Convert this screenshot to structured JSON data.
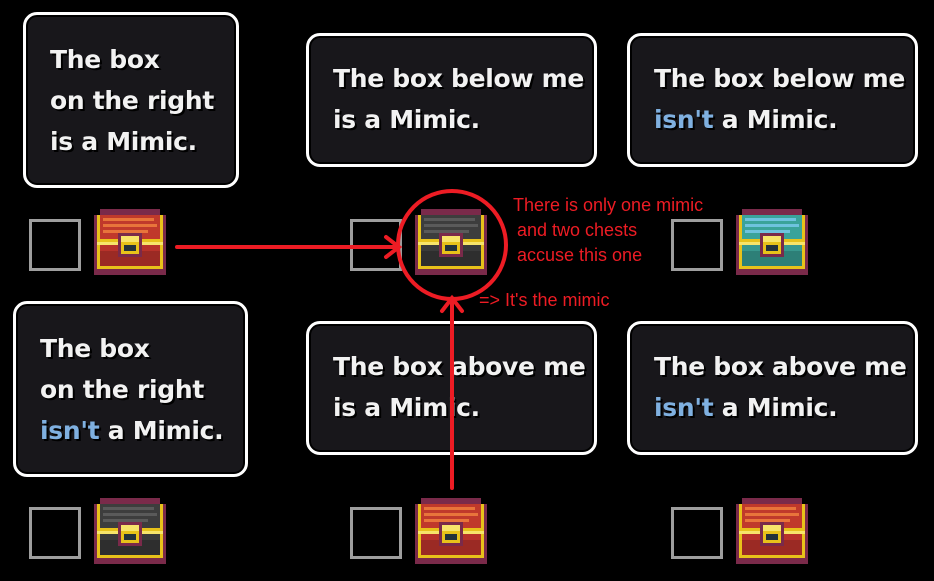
{
  "clues": [
    {
      "lines": [
        {
          "text": "The box"
        },
        {
          "text": "on the right"
        },
        {
          "text": "is a Mimic."
        }
      ]
    },
    {
      "lines": [
        {
          "text": "The box below me"
        },
        {
          "text": "is a Mimic."
        }
      ]
    },
    {
      "lines": [
        {
          "text": "The box below me"
        },
        {
          "neg": "isn't",
          "text": " a Mimic."
        }
      ]
    },
    {
      "lines": [
        {
          "text": "The box"
        },
        {
          "text": "on the right"
        },
        {
          "neg": "isn't",
          "text": " a Mimic."
        }
      ]
    },
    {
      "lines": [
        {
          "text": "The box above me"
        },
        {
          "text": "is a Mimic."
        }
      ]
    },
    {
      "lines": [
        {
          "text": "The box above me"
        },
        {
          "neg": "isn't",
          "text": " a Mimic."
        }
      ]
    }
  ],
  "chests": [
    {
      "color": "red",
      "checked": false
    },
    {
      "color": "gray",
      "checked": false
    },
    {
      "color": "teal",
      "checked": false
    },
    {
      "color": "gray",
      "checked": false
    },
    {
      "color": "red",
      "checked": false
    },
    {
      "color": "red",
      "checked": false
    }
  ],
  "palettes": {
    "red": {
      "lid": "#c0392b",
      "lid_light": "#e8743b",
      "body": "#b8322a",
      "body_dark": "#9b2a24"
    },
    "gray": {
      "lid": "#3d3d3d",
      "lid_light": "#5a5a5a",
      "body": "#3a3a3a",
      "body_dark": "#2e2e2e"
    },
    "teal": {
      "lid": "#3aa39a",
      "lid_light": "#6ec3de",
      "body": "#38988e",
      "body_dark": "#2d7f77"
    }
  },
  "annotation": {
    "color": "#ed1c24",
    "reasoning_lines": [
      "There is only one mimic",
      "and two chests",
      "accuse this one"
    ],
    "conclusion": "=> It's the mimic"
  }
}
